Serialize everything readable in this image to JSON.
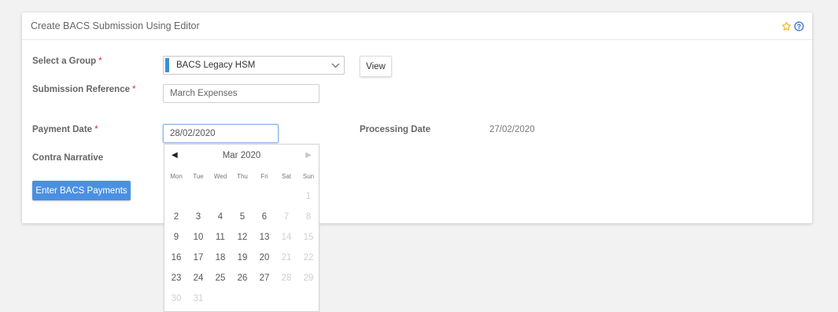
{
  "card": {
    "title": "Create BACS Submission Using Editor",
    "star_icon": "star-icon",
    "help_icon": "help-circle-icon"
  },
  "form": {
    "group_label": "Select a Group",
    "group_value": "BACS Legacy HSM",
    "group_accent_color": "#3b8fd9",
    "view_button": "View",
    "reference_label": "Submission Reference",
    "reference_value": "March Expenses",
    "payment_date_label": "Payment Date",
    "payment_date_value": "28/02/2020",
    "processing_date_label": "Processing Date",
    "processing_date_value": "27/02/2020",
    "contra_label": "Contra Narrative",
    "required_mark": "*",
    "enter_button": "Enter BACS Payments"
  },
  "datepicker": {
    "month_label": "Mar 2020",
    "prev_icon": "prev-triangle-icon",
    "next_icon": "next-triangle-icon",
    "weekdays": [
      "Mon",
      "Tue",
      "Wed",
      "Thu",
      "Fri",
      "Sat",
      "Sun"
    ],
    "weeks": [
      [
        {
          "d": ""
        },
        {
          "d": ""
        },
        {
          "d": ""
        },
        {
          "d": ""
        },
        {
          "d": ""
        },
        {
          "d": ""
        },
        {
          "d": "1",
          "disabled": true
        }
      ],
      [
        {
          "d": "2"
        },
        {
          "d": "3"
        },
        {
          "d": "4"
        },
        {
          "d": "5"
        },
        {
          "d": "6"
        },
        {
          "d": "7",
          "disabled": true
        },
        {
          "d": "8",
          "disabled": true
        }
      ],
      [
        {
          "d": "9"
        },
        {
          "d": "10"
        },
        {
          "d": "11"
        },
        {
          "d": "12"
        },
        {
          "d": "13"
        },
        {
          "d": "14",
          "disabled": true
        },
        {
          "d": "15",
          "disabled": true
        }
      ],
      [
        {
          "d": "16"
        },
        {
          "d": "17"
        },
        {
          "d": "18"
        },
        {
          "d": "19"
        },
        {
          "d": "20"
        },
        {
          "d": "21",
          "disabled": true
        },
        {
          "d": "22",
          "disabled": true
        }
      ],
      [
        {
          "d": "23"
        },
        {
          "d": "24"
        },
        {
          "d": "25"
        },
        {
          "d": "26"
        },
        {
          "d": "27"
        },
        {
          "d": "28",
          "disabled": true
        },
        {
          "d": "29",
          "disabled": true
        }
      ],
      [
        {
          "d": "30",
          "disabled": true
        },
        {
          "d": "31",
          "disabled": true
        },
        {
          "d": ""
        },
        {
          "d": ""
        },
        {
          "d": ""
        },
        {
          "d": ""
        },
        {
          "d": ""
        }
      ]
    ]
  },
  "colors": {
    "primary_button": "#4a90e2",
    "required": "#e02b2b",
    "star": "#f0b323",
    "help": "#3a6fd8"
  }
}
